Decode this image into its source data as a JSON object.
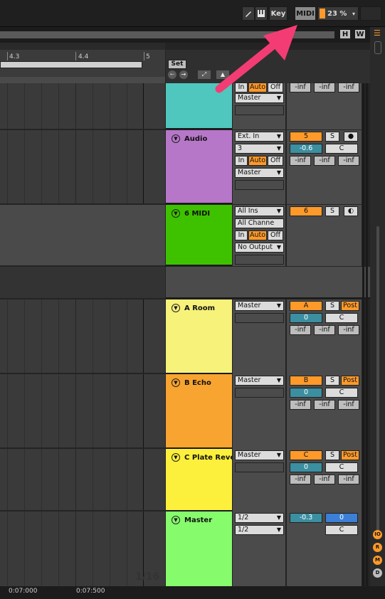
{
  "topbar": {
    "key_label": "Key",
    "midi_label": "MIDI",
    "cpu_label": "23 %"
  },
  "ruler": {
    "h_label": "H",
    "w_label": "W",
    "marks": [
      "4.3",
      "4.4",
      "5"
    ],
    "set_label": "Set"
  },
  "tracks": [
    {
      "name": "",
      "color": "#4fc7bf",
      "io": {
        "monitor": [
          "In",
          "Auto",
          "Off"
        ],
        "output": "Master"
      },
      "mixer": [
        "-inf",
        "-inf",
        "-inf"
      ]
    },
    {
      "name": "Audio",
      "color": "#b777c9",
      "io": {
        "input": "Ext. In",
        "channel": "3",
        "monitor": [
          "In",
          "Auto",
          "Off"
        ],
        "output": "Master"
      },
      "mixer": {
        "number": "5",
        "solo": "S",
        "volume": "-0.6",
        "pan": "C",
        "sends": [
          "-inf",
          "-inf",
          "-inf"
        ]
      }
    },
    {
      "name": "6 MIDI",
      "color": "#3ec200",
      "io": {
        "input": "All Ins",
        "channel": "All Channe",
        "monitor": [
          "In",
          "Auto",
          "Off"
        ],
        "output": "No Output"
      },
      "mixer": {
        "number": "6",
        "solo": "S"
      }
    },
    {
      "name": "A Room",
      "color": "#f6f27a",
      "io": {
        "output": "Master"
      },
      "mixer": {
        "letter": "A",
        "solo": "S",
        "post": "Post",
        "volume": "0",
        "pan": "C",
        "sends": [
          "-inf",
          "-inf",
          "-inf"
        ]
      }
    },
    {
      "name": "B Echo",
      "color": "#f7a431",
      "io": {
        "output": "Master"
      },
      "mixer": {
        "letter": "B",
        "solo": "S",
        "post": "Post",
        "volume": "0",
        "pan": "C",
        "sends": [
          "-inf",
          "-inf",
          "-inf"
        ]
      }
    },
    {
      "name": "C Plate Rever",
      "color": "#fdf03c",
      "io": {
        "output": "Master"
      },
      "mixer": {
        "letter": "C",
        "solo": "S",
        "post": "Post",
        "volume": "0",
        "pan": "C",
        "sends": [
          "-inf",
          "-inf",
          "-inf"
        ]
      }
    },
    {
      "name": "Master",
      "color": "#86fb6c",
      "io": {
        "cue": "1/2",
        "output": "1/2"
      },
      "mixer": {
        "volume": "-0.3",
        "cue_volume": "0",
        "pan": "C"
      }
    }
  ],
  "quantize": "1/16",
  "timeline": [
    "0:07:000",
    "0:07:500"
  ],
  "side_buttons": [
    "IO",
    "R",
    "M",
    "D"
  ],
  "colors": {
    "accent": "#ff9a2a",
    "arrow": "#f43c74"
  }
}
